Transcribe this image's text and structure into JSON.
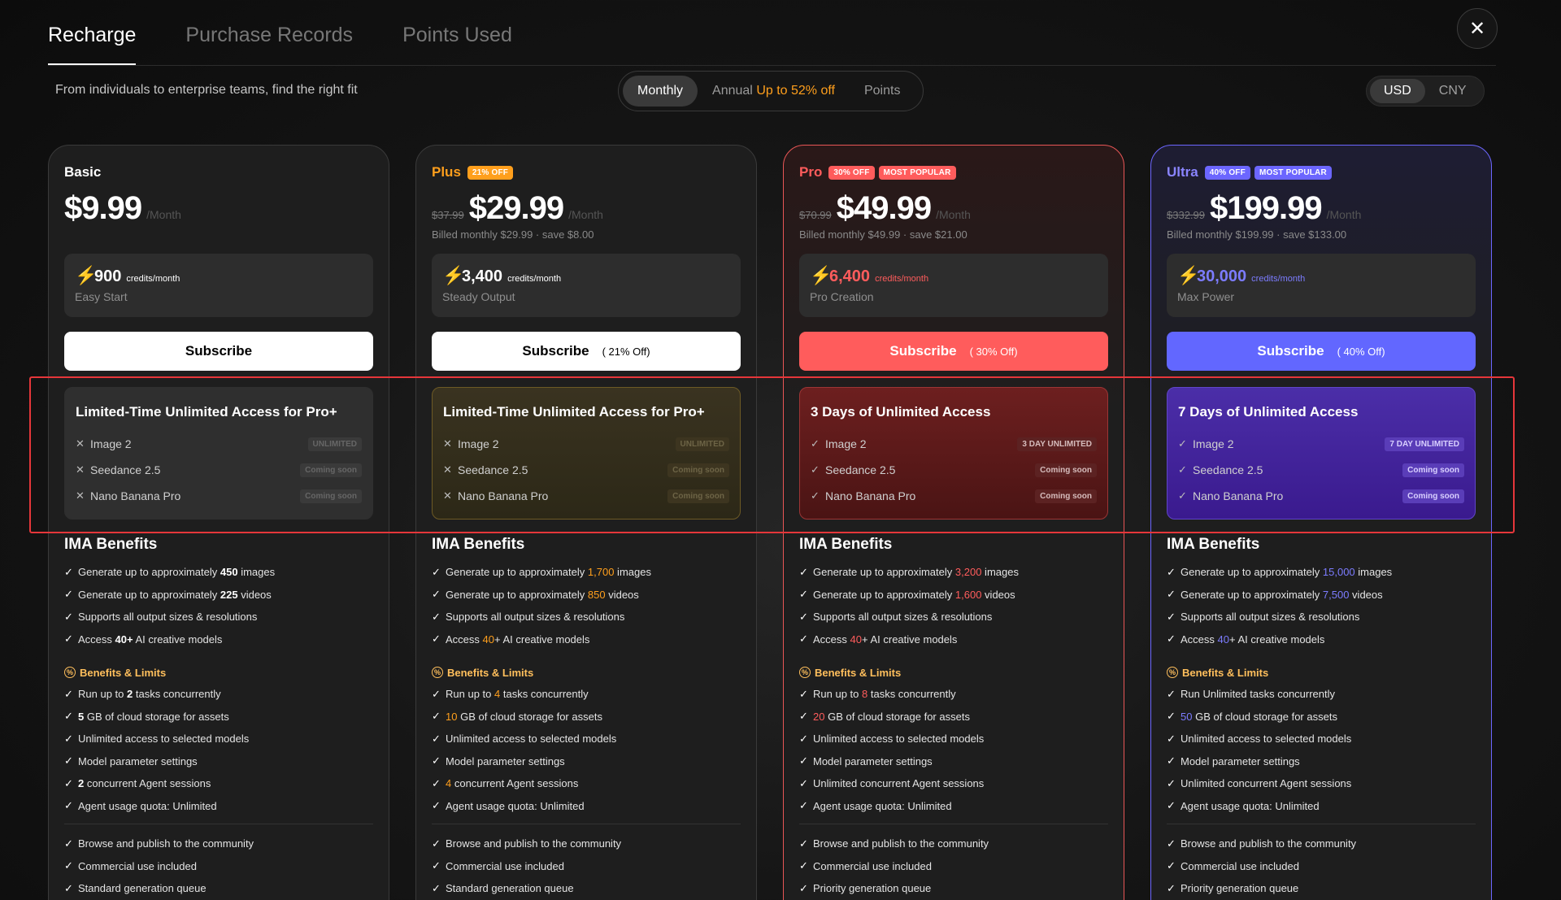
{
  "tabs": [
    {
      "label": "Recharge"
    },
    {
      "label": "Purchase Records"
    },
    {
      "label": "Points Used"
    }
  ],
  "subtitle": "From individuals to enterprise teams, find the right fit",
  "period": {
    "monthly": "Monthly",
    "annual": "Annual",
    "annual_discount": "Up to 52% off",
    "points": "Points"
  },
  "currency": {
    "usd": "USD",
    "cny": "CNY"
  },
  "plans": [
    {
      "name": "Basic",
      "badges": [],
      "old_price": "",
      "price": "$9.99",
      "per": "/Month",
      "billed": "",
      "credits": "900",
      "credits_unit": "credits/month",
      "credits_sub": "Easy Start",
      "subscribe": "Subscribe",
      "subscribe_discount": "",
      "access_title": "Limited-Time Unlimited Access for Pro+",
      "access_rows": [
        {
          "mark": "✕",
          "label": "Image 2",
          "tag": "UNLIMITED"
        },
        {
          "mark": "✕",
          "label": "Seedance 2.5",
          "tag": "Coming soon"
        },
        {
          "mark": "✕",
          "label": "Nano Banana Pro",
          "tag": "Coming soon"
        }
      ],
      "benefits": [
        {
          "pre": "Generate up to approximately ",
          "hl": "450",
          "post": " images"
        },
        {
          "pre": "Generate up to approximately ",
          "hl": "225",
          "post": " videos"
        },
        {
          "pre": "Supports all output sizes & resolutions",
          "hl": "",
          "post": ""
        },
        {
          "pre": "Access ",
          "hl": "40+",
          "post": " AI creative models"
        }
      ],
      "limits": [
        {
          "pre": "Run up to ",
          "hl": "2",
          "post": " tasks concurrently"
        },
        {
          "pre": "",
          "hl": "5",
          "post": " GB of cloud storage for assets"
        },
        {
          "pre": "Unlimited access to selected models",
          "hl": "",
          "post": ""
        },
        {
          "pre": "Model parameter settings",
          "hl": "",
          "post": ""
        },
        {
          "pre": "",
          "hl": "2",
          "post": " concurrent Agent sessions"
        },
        {
          "pre": "Agent usage quota: Unlimited",
          "hl": "",
          "post": ""
        }
      ],
      "extras": [
        "Browse and publish to the community",
        "Commercial use included",
        "Standard generation queue"
      ]
    },
    {
      "name": "Plus",
      "badges": [
        {
          "text": "21% OFF",
          "color": "#ff9f1c"
        }
      ],
      "old_price": "$37.99",
      "price": "$29.99",
      "per": "/Month",
      "billed": "Billed monthly $29.99 · save $8.00",
      "credits": "3,400",
      "credits_unit": "credits/month",
      "credits_sub": "Steady Output",
      "subscribe": "Subscribe",
      "subscribe_discount": "( 21% Off)",
      "access_title": "Limited-Time Unlimited Access for Pro+",
      "access_rows": [
        {
          "mark": "✕",
          "label": "Image 2",
          "tag": "UNLIMITED"
        },
        {
          "mark": "✕",
          "label": "Seedance 2.5",
          "tag": "Coming soon"
        },
        {
          "mark": "✕",
          "label": "Nano Banana Pro",
          "tag": "Coming soon"
        }
      ],
      "benefits": [
        {
          "pre": "Generate up to approximately ",
          "hl": "1,700",
          "post": " images"
        },
        {
          "pre": "Generate up to approximately ",
          "hl": "850",
          "post": " videos"
        },
        {
          "pre": "Supports all output sizes & resolutions",
          "hl": "",
          "post": ""
        },
        {
          "pre": "Access ",
          "hl": "40",
          "post": "+ AI creative models"
        }
      ],
      "limits": [
        {
          "pre": "Run up to ",
          "hl": "4",
          "post": " tasks concurrently"
        },
        {
          "pre": "",
          "hl": "10",
          "post": " GB of cloud storage for assets"
        },
        {
          "pre": "Unlimited access to selected models",
          "hl": "",
          "post": ""
        },
        {
          "pre": "Model parameter settings",
          "hl": "",
          "post": ""
        },
        {
          "pre": "",
          "hl": "4",
          "post": " concurrent Agent sessions"
        },
        {
          "pre": "Agent usage quota: Unlimited",
          "hl": "",
          "post": ""
        }
      ],
      "extras": [
        "Browse and publish to the community",
        "Commercial use included",
        "Standard generation queue"
      ]
    },
    {
      "name": "Pro",
      "badges": [
        {
          "text": "30% OFF",
          "color": "#ff5c5c"
        },
        {
          "text": "MOST POPULAR",
          "color": "#ff5c5c"
        }
      ],
      "old_price": "$70.99",
      "price": "$49.99",
      "per": "/Month",
      "billed": "Billed monthly $49.99 · save $21.00",
      "credits": "6,400",
      "credits_unit": "credits/month",
      "credits_sub": "Pro Creation",
      "subscribe": "Subscribe",
      "subscribe_discount": "( 30% Off)",
      "access_title": "3 Days of Unlimited Access",
      "access_rows": [
        {
          "mark": "✓",
          "label": "Image 2",
          "tag": "3 DAY UNLIMITED"
        },
        {
          "mark": "✓",
          "label": "Seedance 2.5",
          "tag": "Coming soon"
        },
        {
          "mark": "✓",
          "label": "Nano Banana Pro",
          "tag": "Coming soon"
        }
      ],
      "benefits": [
        {
          "pre": "Generate up to approximately ",
          "hl": "3,200",
          "post": " images"
        },
        {
          "pre": "Generate up to approximately ",
          "hl": "1,600",
          "post": " videos"
        },
        {
          "pre": "Supports all output sizes & resolutions",
          "hl": "",
          "post": ""
        },
        {
          "pre": "Access ",
          "hl": "40",
          "post": "+ AI creative models"
        }
      ],
      "limits": [
        {
          "pre": "Run up to ",
          "hl": "8",
          "post": " tasks concurrently"
        },
        {
          "pre": "",
          "hl": "20",
          "post": " GB of cloud storage for assets"
        },
        {
          "pre": "Unlimited access to selected models",
          "hl": "",
          "post": ""
        },
        {
          "pre": "Model parameter settings",
          "hl": "",
          "post": ""
        },
        {
          "pre": "Unlimited concurrent Agent sessions",
          "hl": "",
          "post": ""
        },
        {
          "pre": "Agent usage quota: Unlimited",
          "hl": "",
          "post": ""
        }
      ],
      "extras": [
        "Browse and publish to the community",
        "Commercial use included",
        "Priority generation queue"
      ]
    },
    {
      "name": "Ultra",
      "badges": [
        {
          "text": "40% OFF",
          "color": "#6c66ff"
        },
        {
          "text": "MOST POPULAR",
          "color": "#6c66ff"
        }
      ],
      "old_price": "$332.99",
      "price": "$199.99",
      "per": "/Month",
      "billed": "Billed monthly $199.99 · save $133.00",
      "credits": "30,000",
      "credits_unit": "credits/month",
      "credits_sub": "Max Power",
      "subscribe": "Subscribe",
      "subscribe_discount": "( 40% Off)",
      "access_title": "7 Days of Unlimited Access",
      "access_rows": [
        {
          "mark": "✓",
          "label": "Image 2",
          "tag": "7 DAY UNLIMITED"
        },
        {
          "mark": "✓",
          "label": "Seedance 2.5",
          "tag": "Coming soon"
        },
        {
          "mark": "✓",
          "label": "Nano Banana Pro",
          "tag": "Coming soon"
        }
      ],
      "benefits": [
        {
          "pre": "Generate up to approximately ",
          "hl": "15,000",
          "post": " images"
        },
        {
          "pre": "Generate up to approximately ",
          "hl": "7,500",
          "post": " videos"
        },
        {
          "pre": "Supports all output sizes & resolutions",
          "hl": "",
          "post": ""
        },
        {
          "pre": "Access ",
          "hl": "40",
          "post": "+ AI creative models"
        }
      ],
      "limits": [
        {
          "pre": "Run Unlimited tasks concurrently",
          "hl": "",
          "post": ""
        },
        {
          "pre": "",
          "hl": "50",
          "post": " GB of cloud storage for assets"
        },
        {
          "pre": "Unlimited access to selected models",
          "hl": "",
          "post": ""
        },
        {
          "pre": "Model parameter settings",
          "hl": "",
          "post": ""
        },
        {
          "pre": "Unlimited concurrent Agent sessions",
          "hl": "",
          "post": ""
        },
        {
          "pre": "Agent usage quota: Unlimited",
          "hl": "",
          "post": ""
        }
      ],
      "extras": [
        "Browse and publish to the community",
        "Commercial use included",
        "Priority generation queue"
      ]
    }
  ],
  "labels": {
    "benefits_title": "IMA Benefits",
    "limits_title": "Benefits & Limits"
  },
  "colors": {
    "plus_accent": "#ff9f1c",
    "pro_accent": "#ff5c5c",
    "ultra_accent": "#6c66ff",
    "highlight_box": "#e5363a"
  }
}
